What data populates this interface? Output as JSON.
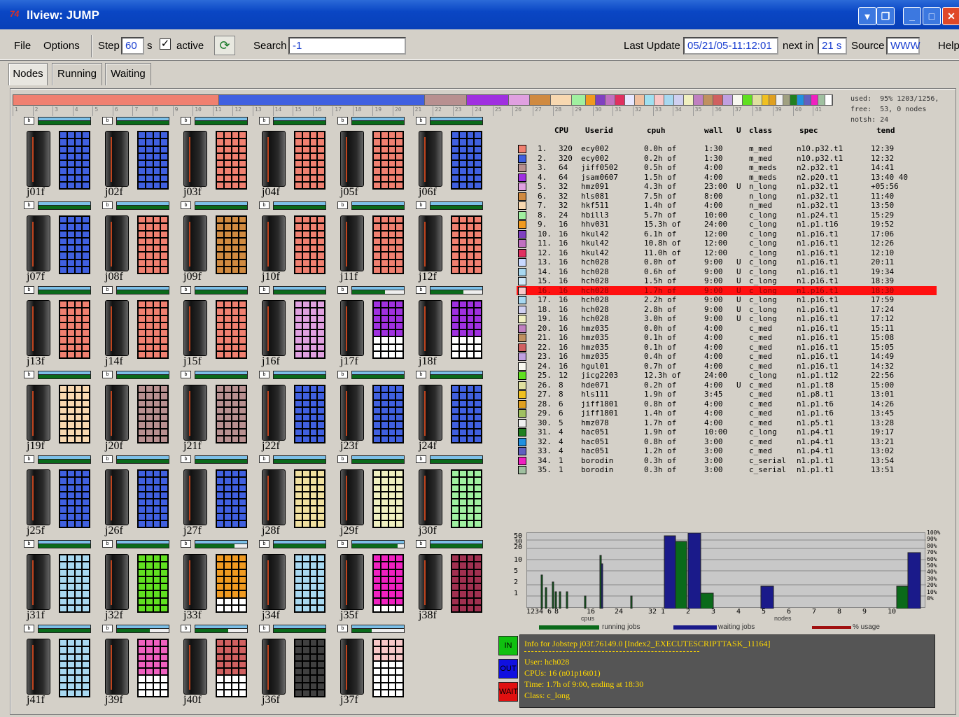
{
  "window": {
    "title": "llview: JUMP",
    "icon": "74"
  },
  "menu": {
    "file": "File",
    "options": "Options",
    "step_label": "Step",
    "step_value": "60",
    "step_unit": "s",
    "active_label": "active",
    "search_label": "Search",
    "search_value": "-1",
    "last_update_label": "Last Update",
    "last_update_value": "05/21/05-11:12:01",
    "next_in_label": "next in",
    "next_in_value": "21 s",
    "source_label": "Source",
    "source_value": "WWW",
    "help": "Help"
  },
  "tabs": [
    "Nodes",
    "Running",
    "Waiting"
  ],
  "usage": {
    "used": "used:  95% 1203/1256,",
    "free": "free:  53, 0 nodes",
    "notsh": "notsh: 24"
  },
  "node_scale": [
    "1",
    "2",
    "3",
    "4",
    "5",
    "6",
    "7",
    "8",
    "9",
    "10",
    "11",
    "12",
    "13",
    "14",
    "15",
    "16",
    "17",
    "18",
    "19",
    "20",
    "21",
    "22",
    "23",
    "24",
    "25",
    "26",
    "27",
    "28",
    "29",
    "30",
    "31",
    "32",
    "33",
    "34",
    "35",
    "36",
    "37",
    "38",
    "39",
    "40",
    "41"
  ],
  "colors": {
    "c1": "#f08070",
    "c2": "#4060e0",
    "c3": "#b89090",
    "c4": "#a030e0",
    "c5": "#e0a0e0",
    "c6": "#d08a40",
    "c7": "#f8d8b0",
    "c8": "#a0f0a0",
    "c9": "#f09a20",
    "c10": "#8040c0",
    "c11": "#c070c0",
    "c12": "#e03060",
    "c13": "#e8e8ff",
    "c14": "#f0c0a0",
    "c15": "#a0e0f0",
    "c16": "#f8c8c8",
    "c17": "#a8d8f0",
    "c18": "#d0d0f0",
    "c19": "#f0f0c0",
    "c20": "#c080c0",
    "c21": "#c09060",
    "c22": "#d06060",
    "c23": "#c0a0e0",
    "c24": "#f8f8f0",
    "c25": "#60e020",
    "c26": "#e0e0a0",
    "c27": "#f0c020",
    "c28": "#e0a020",
    "c29": "#f0f0f0",
    "c30": "#a0a080",
    "c31": "#208020",
    "c32": "#2090e0",
    "c33": "#6060c0",
    "c34": "#f020c0",
    "c35": "#a0c0a0"
  },
  "nodes": [
    {
      "id": "j01f",
      "color": "#4060e0",
      "fill": 32
    },
    {
      "id": "j02f",
      "color": "#4060e0",
      "fill": 32
    },
    {
      "id": "j03f",
      "color": "#f08070",
      "fill": 32
    },
    {
      "id": "j04f",
      "color": "#f08070",
      "fill": 32
    },
    {
      "id": "j05f",
      "color": "#f08070",
      "fill": 32
    },
    {
      "id": "j06f",
      "color": "#4060e0",
      "fill": 32
    },
    {
      "id": "j07f",
      "color": "#4060e0",
      "fill": 32
    },
    {
      "id": "j08f",
      "color": "#f08070",
      "fill": 32
    },
    {
      "id": "j09f",
      "color": "#d08a40",
      "fill": 32
    },
    {
      "id": "j10f",
      "color": "#f08070",
      "fill": 32
    },
    {
      "id": "j11f",
      "color": "#f08070",
      "fill": 32
    },
    {
      "id": "j12f",
      "color": "#f08070",
      "fill": 32
    },
    {
      "id": "j13f",
      "color": "#f08070",
      "fill": 32
    },
    {
      "id": "j14f",
      "color": "#f08070",
      "fill": 32
    },
    {
      "id": "j15f",
      "color": "#f08070",
      "fill": 32
    },
    {
      "id": "j16f",
      "color": "#e0a0e0",
      "fill": 32
    },
    {
      "id": "j17f",
      "color": "#a030e0",
      "fill": 20
    },
    {
      "id": "j18f",
      "color": "#a030e0",
      "fill": 20
    },
    {
      "id": "j19f",
      "color": "#f8d8b0",
      "fill": 32
    },
    {
      "id": "j20f",
      "color": "#b89090",
      "fill": 32
    },
    {
      "id": "j21f",
      "color": "#b89090",
      "fill": 32
    },
    {
      "id": "j22f",
      "color": "#4060e0",
      "fill": 32
    },
    {
      "id": "j23f",
      "color": "#4060e0",
      "fill": 32
    },
    {
      "id": "j24f",
      "color": "#4060e0",
      "fill": 32
    },
    {
      "id": "j25f",
      "color": "#4060e0",
      "fill": 32
    },
    {
      "id": "j26f",
      "color": "#4060e0",
      "fill": 32
    },
    {
      "id": "j27f",
      "color": "#4060e0",
      "fill": 32
    },
    {
      "id": "j28f",
      "color": "#f0e0a0",
      "fill": 32
    },
    {
      "id": "j29f",
      "color": "#f0f0c0",
      "fill": 32
    },
    {
      "id": "j30f",
      "color": "#a0f0a0",
      "fill": 32
    },
    {
      "id": "j31f",
      "color": "#a8d8f0",
      "fill": 32
    },
    {
      "id": "j32f",
      "color": "#60e020",
      "fill": 32
    },
    {
      "id": "j33f",
      "color": "#f09a20",
      "fill": 24
    },
    {
      "id": "j34f",
      "color": "#a8d8f0",
      "fill": 32
    },
    {
      "id": "j35f",
      "color": "#f020c0",
      "fill": 28
    },
    {
      "id": "j38f",
      "color": "#a03050",
      "fill": 32
    },
    {
      "id": "j41f",
      "color": "#a8d8f0",
      "fill": 32
    },
    {
      "id": "j39f",
      "color": "#f060c0",
      "fill": 20
    },
    {
      "id": "j40f",
      "color": "#d06060",
      "fill": 20
    },
    {
      "id": "j36f",
      "color": "#404040",
      "fill": 32
    },
    {
      "id": "j37f",
      "color": "#f8c8c8",
      "fill": 12
    }
  ],
  "table": {
    "headers": {
      "cpu": "CPU",
      "userid": "Userid",
      "cpuh": "cpuh",
      "wall": "wall",
      "u": "U",
      "class": "class",
      "spec": "spec",
      "tend": "tend"
    },
    "rows": [
      {
        "n": "1.",
        "cpu": "320",
        "user": "ecy002",
        "cpuh": "0.0h of",
        "wall": "1:30",
        "u": "",
        "cls": "m_med",
        "spec": "n10.p32.t1",
        "tend": "12:39",
        "color": "#f08070"
      },
      {
        "n": "2.",
        "cpu": "320",
        "user": "ecy002",
        "cpuh": "0.2h of",
        "wall": "1:30",
        "u": "",
        "cls": "m_med",
        "spec": "n10.p32.t1",
        "tend": "12:32",
        "color": "#4060e0"
      },
      {
        "n": "3.",
        "cpu": "64",
        "user": "jiff0502",
        "cpuh": "0.5h of",
        "wall": "4:00",
        "u": "",
        "cls": "m_meds",
        "spec": "n2.p32.t1",
        "tend": "14:41",
        "color": "#b89090"
      },
      {
        "n": "4.",
        "cpu": "64",
        "user": "jsam0607",
        "cpuh": "1.5h of",
        "wall": "4:00",
        "u": "",
        "cls": "m_meds",
        "spec": "n2.p20.t1",
        "tend": "13:40 40",
        "color": "#a030e0"
      },
      {
        "n": "5.",
        "cpu": "32",
        "user": "hmz091",
        "cpuh": "4.3h of",
        "wall": "23:00",
        "u": "U",
        "cls": "n_long",
        "spec": "n1.p32.t1",
        "tend": "+05:56",
        "color": "#e0a0e0"
      },
      {
        "n": "6.",
        "cpu": "32",
        "user": "hls081",
        "cpuh": "7.5h of",
        "wall": "8:00",
        "u": "",
        "cls": "n_long",
        "spec": "n1.p32.t1",
        "tend": "11:40",
        "color": "#d08a40"
      },
      {
        "n": "7.",
        "cpu": "32",
        "user": "hkf511",
        "cpuh": "1.4h of",
        "wall": "4:00",
        "u": "",
        "cls": "n_med",
        "spec": "n1.p32.t1",
        "tend": "13:50",
        "color": "#f8d8b0"
      },
      {
        "n": "8.",
        "cpu": "24",
        "user": "hbill3",
        "cpuh": "5.7h of",
        "wall": "10:00",
        "u": "",
        "cls": "c_long",
        "spec": "n1.p24.t1",
        "tend": "15:29",
        "color": "#a0f0a0"
      },
      {
        "n": "9.",
        "cpu": "16",
        "user": "hhv031",
        "cpuh": "15.3h of",
        "wall": "24:00",
        "u": "",
        "cls": "c_long",
        "spec": "n1.p1.t16",
        "tend": "19:52",
        "color": "#f09a20"
      },
      {
        "n": "10.",
        "cpu": "16",
        "user": "hkul42",
        "cpuh": "6.1h of",
        "wall": "12:00",
        "u": "",
        "cls": "c_long",
        "spec": "n1.p16.t1",
        "tend": "17:06",
        "color": "#8040c0"
      },
      {
        "n": "11.",
        "cpu": "16",
        "user": "hkul42",
        "cpuh": "10.8h of",
        "wall": "12:00",
        "u": "",
        "cls": "c_long",
        "spec": "n1.p16.t1",
        "tend": "12:26",
        "color": "#c070c0"
      },
      {
        "n": "12.",
        "cpu": "16",
        "user": "hkul42",
        "cpuh": "11.0h of",
        "wall": "12:00",
        "u": "",
        "cls": "c_long",
        "spec": "n1.p16.t1",
        "tend": "12:10",
        "color": "#e03060"
      },
      {
        "n": "13.",
        "cpu": "16",
        "user": "hch028",
        "cpuh": "0.0h of",
        "wall": "9:00",
        "u": "U",
        "cls": "c_long",
        "spec": "n1.p16.t1",
        "tend": "20:11",
        "color": "#c8d8ff"
      },
      {
        "n": "14.",
        "cpu": "16",
        "user": "hch028",
        "cpuh": "0.6h of",
        "wall": "9:00",
        "u": "U",
        "cls": "c_long",
        "spec": "n1.p16.t1",
        "tend": "19:34",
        "color": "#a8d8f0"
      },
      {
        "n": "15.",
        "cpu": "16",
        "user": "hch028",
        "cpuh": "1.5h of",
        "wall": "9:00",
        "u": "U",
        "cls": "c_long",
        "spec": "n1.p16.t1",
        "tend": "18:39",
        "color": "#d0e8f8"
      },
      {
        "n": "16.",
        "cpu": "16",
        "user": "hch028",
        "cpuh": "1.7h of",
        "wall": "9:00",
        "u": "U",
        "cls": "c_long",
        "spec": "n1.p16.t1",
        "tend": "18:30",
        "color": "#f8c8c8",
        "sel": true
      },
      {
        "n": "17.",
        "cpu": "16",
        "user": "hch028",
        "cpuh": "2.2h of",
        "wall": "9:00",
        "u": "U",
        "cls": "c_long",
        "spec": "n1.p16.t1",
        "tend": "17:59",
        "color": "#a8d8f0"
      },
      {
        "n": "18.",
        "cpu": "16",
        "user": "hch028",
        "cpuh": "2.8h of",
        "wall": "9:00",
        "u": "U",
        "cls": "c_long",
        "spec": "n1.p16.t1",
        "tend": "17:24",
        "color": "#d0d0f0"
      },
      {
        "n": "19.",
        "cpu": "16",
        "user": "hch028",
        "cpuh": "3.0h of",
        "wall": "9:00",
        "u": "U",
        "cls": "c_long",
        "spec": "n1.p16.t1",
        "tend": "17:12",
        "color": "#f0f0c0"
      },
      {
        "n": "20.",
        "cpu": "16",
        "user": "hmz035",
        "cpuh": "0.0h of",
        "wall": "4:00",
        "u": "",
        "cls": "c_med",
        "spec": "n1.p16.t1",
        "tend": "15:11",
        "color": "#c080c0"
      },
      {
        "n": "21.",
        "cpu": "16",
        "user": "hmz035",
        "cpuh": "0.1h of",
        "wall": "4:00",
        "u": "",
        "cls": "c_med",
        "spec": "n1.p16.t1",
        "tend": "15:08",
        "color": "#c09060"
      },
      {
        "n": "22.",
        "cpu": "16",
        "user": "hmz035",
        "cpuh": "0.1h of",
        "wall": "4:00",
        "u": "",
        "cls": "c_med",
        "spec": "n1.p16.t1",
        "tend": "15:05",
        "color": "#d06060"
      },
      {
        "n": "23.",
        "cpu": "16",
        "user": "hmz035",
        "cpuh": "0.4h of",
        "wall": "4:00",
        "u": "",
        "cls": "c_med",
        "spec": "n1.p16.t1",
        "tend": "14:49",
        "color": "#c0a0e0"
      },
      {
        "n": "24.",
        "cpu": "16",
        "user": "hgul01",
        "cpuh": "0.7h of",
        "wall": "4:00",
        "u": "",
        "cls": "c_med",
        "spec": "n1.p16.t1",
        "tend": "14:32",
        "color": "#f8f8f0"
      },
      {
        "n": "25.",
        "cpu": "12",
        "user": "jicg2203",
        "cpuh": "12.3h of",
        "wall": "24:00",
        "u": "",
        "cls": "c_long",
        "spec": "n1.p1.t12",
        "tend": "22:56",
        "color": "#60e020"
      },
      {
        "n": "26.",
        "cpu": "8",
        "user": "hde071",
        "cpuh": "0.2h of",
        "wall": "4:00",
        "u": "U",
        "cls": "c_med",
        "spec": "n1.p1.t8",
        "tend": "15:00",
        "color": "#e0e0a0"
      },
      {
        "n": "27.",
        "cpu": "8",
        "user": "hls111",
        "cpuh": "1.9h of",
        "wall": "3:45",
        "u": "",
        "cls": "c_med",
        "spec": "n1.p8.t1",
        "tend": "13:01",
        "color": "#f0c020"
      },
      {
        "n": "28.",
        "cpu": "6",
        "user": "jiff1801",
        "cpuh": "0.8h of",
        "wall": "4:00",
        "u": "",
        "cls": "c_med",
        "spec": "n1.p1.t6",
        "tend": "14:26",
        "color": "#e0a020"
      },
      {
        "n": "29.",
        "cpu": "6",
        "user": "jiff1801",
        "cpuh": "1.4h of",
        "wall": "4:00",
        "u": "",
        "cls": "c_med",
        "spec": "n1.p1.t6",
        "tend": "13:45",
        "color": "#a0c060"
      },
      {
        "n": "30.",
        "cpu": "5",
        "user": "hmz078",
        "cpuh": "1.7h of",
        "wall": "4:00",
        "u": "",
        "cls": "c_med",
        "spec": "n1.p5.t1",
        "tend": "13:28",
        "color": "#f0f0f0"
      },
      {
        "n": "31.",
        "cpu": "4",
        "user": "hac051",
        "cpuh": "1.9h of",
        "wall": "10:00",
        "u": "",
        "cls": "c_long",
        "spec": "n1.p4.t1",
        "tend": "19:17",
        "color": "#208020"
      },
      {
        "n": "32.",
        "cpu": "4",
        "user": "hac051",
        "cpuh": "0.8h of",
        "wall": "3:00",
        "u": "",
        "cls": "c_med",
        "spec": "n1.p4.t1",
        "tend": "13:21",
        "color": "#2090e0"
      },
      {
        "n": "33.",
        "cpu": "4",
        "user": "hac051",
        "cpuh": "1.2h of",
        "wall": "3:00",
        "u": "",
        "cls": "c_med",
        "spec": "n1.p4.t1",
        "tend": "13:02",
        "color": "#6060c0"
      },
      {
        "n": "34.",
        "cpu": "1",
        "user": "borodin",
        "cpuh": "0.3h of",
        "wall": "3:00",
        "u": "",
        "cls": "c_serial",
        "spec": "n1.p1.t1",
        "tend": "13:54",
        "color": "#f020c0"
      },
      {
        "n": "35.",
        "cpu": "1",
        "user": "borodin",
        "cpuh": "0.3h of",
        "wall": "3:00",
        "u": "",
        "cls": "c_serial",
        "spec": "n1.p1.t1",
        "tend": "13:51",
        "color": "#a0c0a0"
      }
    ]
  },
  "histogram": {
    "y_ticks": [
      "50",
      "30",
      "20",
      "10",
      "5",
      "2",
      "1"
    ],
    "x_cpu_ticks": [
      "1234",
      "6",
      "8",
      "16",
      "24",
      "32"
    ],
    "x_node_ticks": [
      "1",
      "2",
      "3",
      "4",
      "5",
      "6",
      "7",
      "8",
      "9",
      "10"
    ],
    "pct_ticks": [
      "100%",
      "90%",
      "80%",
      "70%",
      "60%",
      "50%",
      "40%",
      "30%",
      "20%",
      "10%",
      "0%"
    ],
    "cpus_label": "cpus",
    "nodes_label": "nodes",
    "legend_running": "running jobs",
    "legend_waiting": "waiting jobs",
    "legend_usage": "% usage"
  },
  "info": {
    "in": "IN",
    "out": "OUT",
    "wait": "WAIT",
    "title": "Info for Jobstep j03f.76149.0 [Index2_EXECUTESCRIPTTASK_11164]",
    "user": "User:   hch028",
    "cpus": "CPUs:   16 (n01p16t01)",
    "time": "Time:   1.7h of 9:00, ending at 18:30",
    "class": "Class:  c_long"
  }
}
